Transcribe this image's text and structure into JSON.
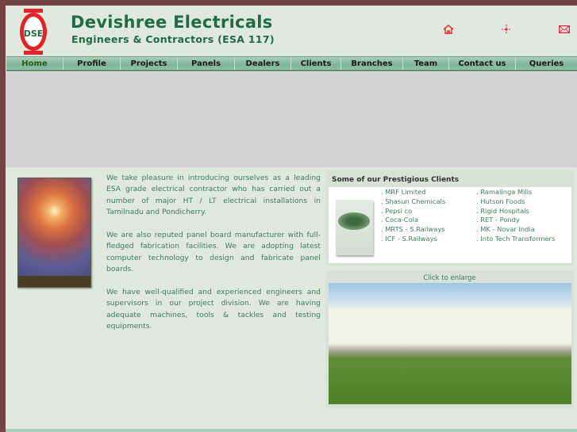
{
  "header": {
    "logo_text": "DSE",
    "title": "Devishree Electricals",
    "subtitle": "Engineers & Contractors (ESA 117)",
    "icons": [
      "home-icon",
      "sitemap-icon",
      "mail-icon"
    ]
  },
  "nav": [
    {
      "label": "Home",
      "active": true
    },
    {
      "label": "Profile"
    },
    {
      "label": "Projects"
    },
    {
      "label": "Panels"
    },
    {
      "label": "Dealers"
    },
    {
      "label": "Clients"
    },
    {
      "label": "Branches"
    },
    {
      "label": "Team"
    },
    {
      "label": "Contact us"
    },
    {
      "label": "Queries"
    }
  ],
  "intro": [
    "We take pleasure in introducing ourselves as a leading ESA grade electrical contractor who has carried out a number of major HT / LT electrical installations in Tamilnadu and Pondicherry.",
    "We are also reputed panel board manufacturer with full-fledged fabrication facilities. We are adopting latest computer technology to design and fabricate panel boards.",
    "We have well-qualified and experienced engineers and supervisors in our project division. We are having adequate machines, tools & tackles and testing equipments."
  ],
  "clients": {
    "heading": "Some of our Prestigious Clients",
    "col1": [
      ". MRF Limited",
      ". Shasun Chemicals",
      ". Pepsi co",
      ". Coca-Cola",
      ". MRTS - S.Railways",
      ". ICF - S.Railways"
    ],
    "col2": [
      ". Ramalinga Mills",
      ". Hutson Foods",
      ". Rigid Hospitals",
      ". RET - Pondy",
      ". MK - Novar India",
      ". Into Tech Transformers"
    ]
  },
  "photo": {
    "caption": "Click to enlarge"
  },
  "colors": {
    "border": "#744444",
    "bg": "#dfe9dd",
    "brand": "#1f6b45",
    "text": "#3f7b5a",
    "icon": "#e8202a"
  }
}
